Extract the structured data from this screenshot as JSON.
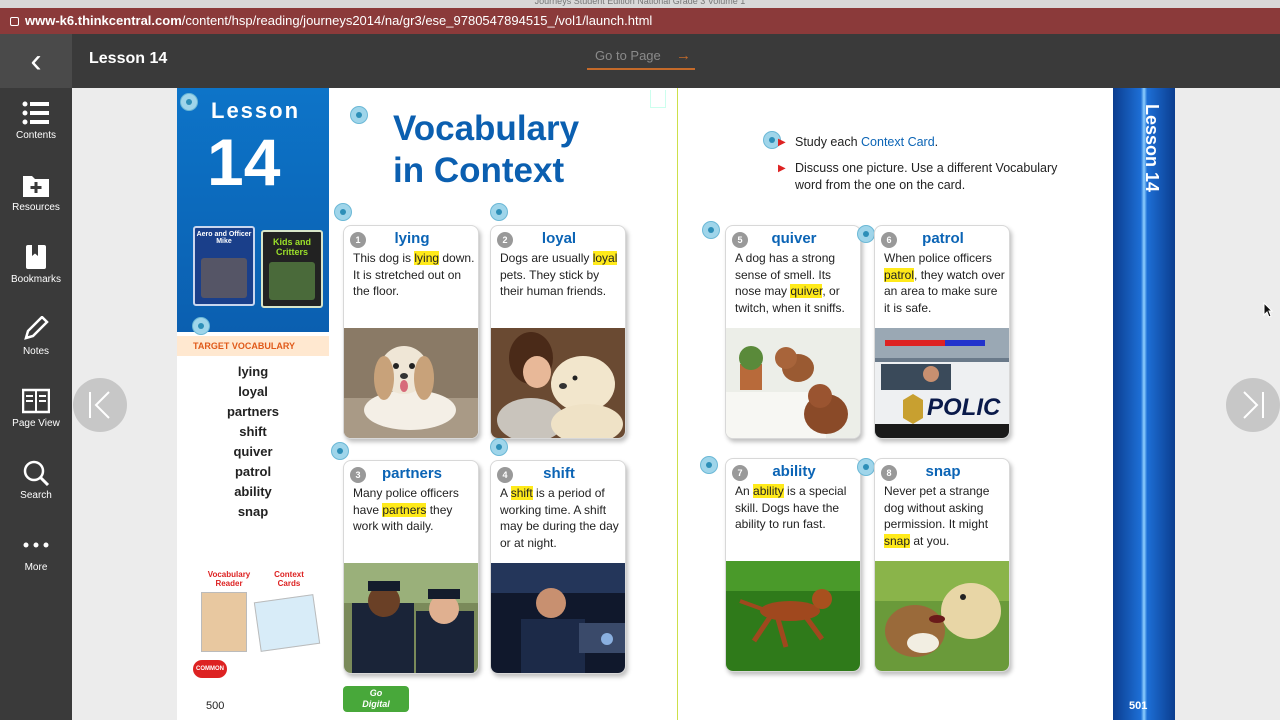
{
  "window": {
    "title": "Journeys Student Edition National Grade 3 Volume 1"
  },
  "url": {
    "host": "www-k6.thinkcentral.com",
    "path": "/content/hsp/reading/journeys2014/na/gr3/ese_9780547894515_/vol1/launch.html"
  },
  "header": {
    "lesson_title": "Lesson 14",
    "goto_label": "Go to Page",
    "goto_arrow": "→",
    "back_glyph": "‹"
  },
  "sidebar": {
    "items": [
      {
        "label": "Contents",
        "icon": "list-icon"
      },
      {
        "label": "Resources",
        "icon": "folder-plus-icon"
      },
      {
        "label": "Bookmarks",
        "icon": "bookmark-book-icon"
      },
      {
        "label": "Notes",
        "icon": "pencil-icon"
      },
      {
        "label": "Page View",
        "icon": "page-view-icon"
      },
      {
        "label": "Search",
        "icon": "search-icon"
      },
      {
        "label": "More",
        "icon": "more-dots-icon"
      }
    ]
  },
  "left_page": {
    "lesson_word": "Lesson",
    "lesson_number": "14",
    "book1_title": "Aero and Officer Mike",
    "book2_title": "Kids and Critters",
    "target_vocab_label": "TARGET VOCABULARY",
    "vocab_words": [
      "lying",
      "loyal",
      "partners",
      "shift",
      "quiver",
      "patrol",
      "ability",
      "snap"
    ],
    "resource1_label": "Vocabulary Reader",
    "resource2_label": "Context Cards",
    "common_core_label": "COMMON CORE",
    "page_number": "500",
    "heading_line1": "Vocabulary",
    "heading_line2": "in Context",
    "go_digital_line1": "Go",
    "go_digital_line2": "Digital"
  },
  "right_page": {
    "instruction1_pre": "Study each ",
    "instruction1_link": "Context Card",
    "instruction1_post": ".",
    "instruction2": "Discuss one picture. Use a different Vocabulary word from the one on the card.",
    "band_label": "Lesson 14",
    "page_number": "501"
  },
  "cards": [
    {
      "num": "1",
      "word": "lying",
      "pre": "This dog is ",
      "hl": "lying",
      "post": " down. It is stretched out on the floor."
    },
    {
      "num": "2",
      "word": "loyal",
      "pre": "Dogs are usually ",
      "hl": "loyal",
      "post": " pets. They stick by their human friends."
    },
    {
      "num": "3",
      "word": "partners",
      "pre": "Many police officers have ",
      "hl": "partners",
      "post": " they work with daily."
    },
    {
      "num": "4",
      "word": "shift",
      "pre": "A ",
      "hl": "shift",
      "post": " is a period of working time. A shift may be during the day or at night."
    },
    {
      "num": "5",
      "word": "quiver",
      "pre": "A dog has a strong sense of smell. Its nose may ",
      "hl": "quiver",
      "post": ", or twitch, when it sniffs."
    },
    {
      "num": "6",
      "word": "patrol",
      "pre": "When police officers ",
      "hl": "patrol",
      "post": ", they watch over an area to make sure it is safe."
    },
    {
      "num": "7",
      "word": "ability",
      "pre": "An ",
      "hl": "ability",
      "post": " is a special skill. Dogs have the ability to run fast."
    },
    {
      "num": "8",
      "word": "snap",
      "pre": "Never pet a strange dog without asking permission. It might ",
      "hl": "snap",
      "post": " at you."
    }
  ],
  "police_sign": "POLIC",
  "colors": {
    "url_bar": "#8b3a3a",
    "toolbar": "#3a3a3a",
    "accent_blue": "#0b64b5",
    "highlight": "#ffea1a",
    "goto_underline": "#c46a2a"
  }
}
